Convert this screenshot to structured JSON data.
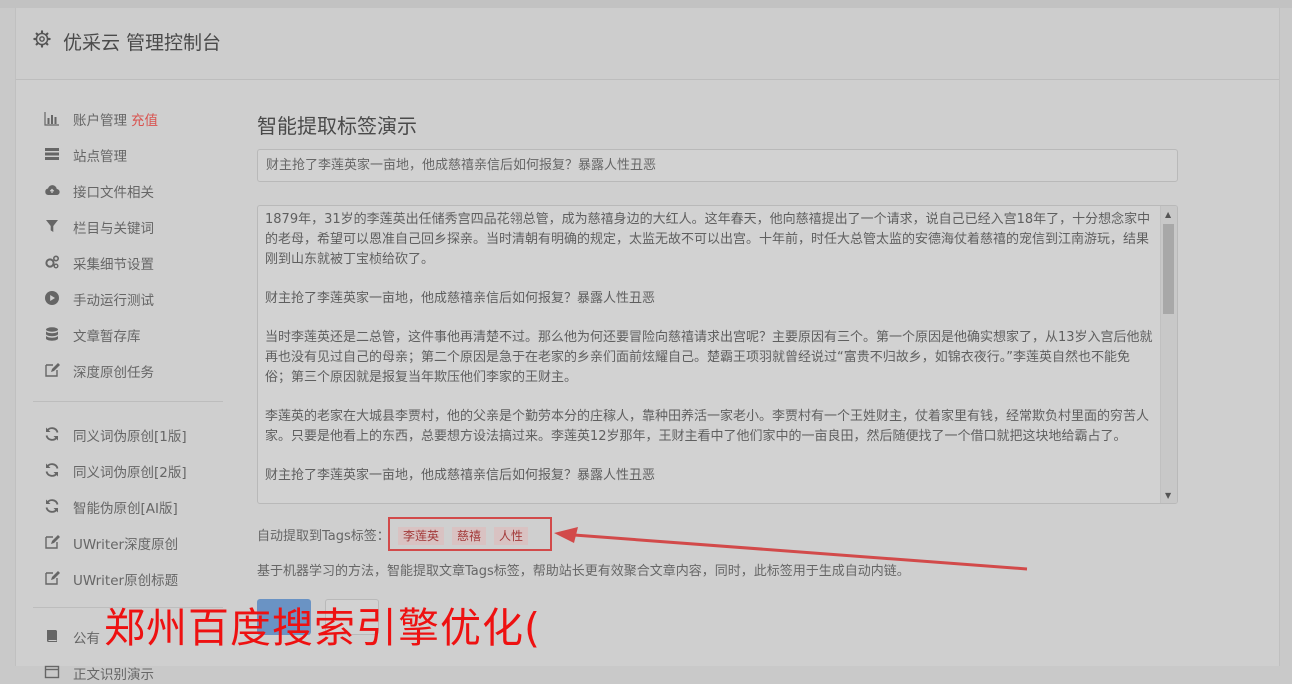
{
  "header": {
    "title": "优采云 管理控制台"
  },
  "sidebar": {
    "items": [
      {
        "label": "账户管理",
        "badge": "充值",
        "icon": "bar-chart-icon"
      },
      {
        "label": "站点管理",
        "icon": "server-icon"
      },
      {
        "label": "接口文件相关",
        "icon": "cloud-upload-icon"
      },
      {
        "label": "栏目与关键词",
        "icon": "filter-icon"
      },
      {
        "label": "采集细节设置",
        "icon": "gears-icon"
      },
      {
        "label": "手动运行测试",
        "icon": "play-circle-icon"
      },
      {
        "label": "文章暂存库",
        "icon": "database-icon"
      },
      {
        "label": "深度原创任务",
        "icon": "edit-icon"
      },
      {
        "label": "同义词伪原创[1版]",
        "icon": "refresh-icon"
      },
      {
        "label": "同义词伪原创[2版]",
        "icon": "refresh-icon"
      },
      {
        "label": "智能伪原创[AI版]",
        "icon": "refresh-icon"
      },
      {
        "label": "UWriter深度原创",
        "icon": "edit-icon"
      },
      {
        "label": "UWriter原创标题",
        "icon": "edit-icon"
      },
      {
        "label": "公有",
        "icon": "book-icon"
      },
      {
        "label": "正文识别演示",
        "icon": "window-icon"
      }
    ]
  },
  "main": {
    "heading": "智能提取标签演示",
    "title_value": "财主抢了李莲英家一亩地，他成慈禧亲信后如何报复？暴露人性丑恶",
    "content_paragraphs": [
      "1879年，31岁的李莲英出任储秀宫四品花翎总管，成为慈禧身边的大红人。这年春天，他向慈禧提出了一个请求，说自己已经入宫18年了，十分想念家中的老母，希望可以恩准自己回乡探亲。当时清朝有明确的规定，太监无故不可以出宫。十年前，时任大总管太监的安德海仗着慈禧的宠信到江南游玩，结果刚到山东就被丁宝桢给砍了。",
      "财主抢了李莲英家一亩地，他成慈禧亲信后如何报复？暴露人性丑恶",
      "当时李莲英还是二总管，这件事他再清楚不过。那么他为何还要冒险向慈禧请求出宫呢？主要原因有三个。第一个原因是他确实想家了，从13岁入宫后他就再也没有见过自己的母亲；第二个原因是急于在老家的乡亲们面前炫耀自己。楚霸王项羽就曾经说过“富贵不归故乡，如锦衣夜行。”李莲英自然也不能免俗；第三个原因就是报复当年欺压他们李家的王财主。",
      "李莲英的老家在大城县李贾村，他的父亲是个勤劳本分的庄稼人，靠种田养活一家老小。李贾村有一个王姓财主，仗着家里有钱，经常欺负村里面的穷苦人家。只要是他看上的东西，总要想方设法搞过来。李莲英12岁那年，王财主看中了他们家中的一亩良田，然后随便找了一个借口就把这块地给霸占了。",
      "财主抢了李莲英家一亩地，他成慈禧亲信后如何报复？暴露人性丑恶"
    ],
    "tags_label": "自动提取到Tags标签：",
    "tags": [
      "李莲英",
      "慈禧",
      "人性"
    ],
    "description": "基于机器学习的方法，智能提取文章Tags标签，帮助站长更有效聚合文章内容，同时，此标签用于生成自动内链。"
  },
  "watermark": "郑州百度搜索引擎优化(",
  "colors": {
    "accent": "#d24a4a",
    "primary_button": "#6a93c4",
    "watermark": "#ee1111"
  }
}
